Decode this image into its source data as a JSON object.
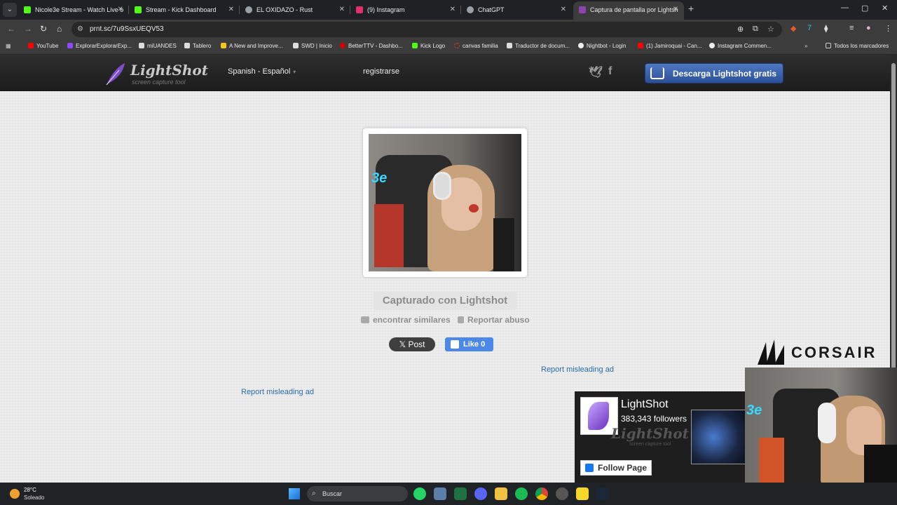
{
  "browser": {
    "tabs": [
      {
        "title": "Nicole3e Stream - Watch Live o",
        "color": "#53fc18"
      },
      {
        "title": "Stream - Kick Dashboard",
        "color": "#53fc18"
      },
      {
        "title": "EL OXIDAZO - Rust",
        "color": "#9aa0a6"
      },
      {
        "title": "(9) Instagram",
        "color": "#e1306c"
      },
      {
        "title": "ChatGPT",
        "color": "#9aa0a6"
      },
      {
        "title": "Captura de pantalla por Lightsh",
        "color": "#8e44ad"
      }
    ],
    "url": "prnt.sc/7u9SsxUEQV53",
    "bookmarks": [
      "YouTube",
      "ExplorarExplorarExp...",
      "miUANDES",
      "Tablero",
      "A New and Improve...",
      "SWD | Inicio",
      "BetterTTV - Dashbo...",
      "Kick Logo",
      "canvas familia",
      "Traductor de docum...",
      "Nightbot - Login",
      "(1) Jamiroquai - Can...",
      "Instagram Commen..."
    ],
    "bookmarks_folder": "Todos los marcadores"
  },
  "lightshot": {
    "logo_name": "LightShot",
    "logo_tagline": "screen capture tool",
    "language": "Spanish - Español",
    "register": "registrarse",
    "download_button": "Descarga Lightshot gratis",
    "caption": "Capturado con Lightshot",
    "find_similar": "encontrar similares",
    "report_abuse": "Reportar abuso",
    "x_post": "Post",
    "fb_like": "Like",
    "fb_like_count": "0",
    "report_ad_1": "Report misleading ad",
    "report_ad_2": "Report misleading ad",
    "image_overlay_text": "3e"
  },
  "fb_widget": {
    "page_name": "LightShot",
    "followers": "383,343 followers",
    "watermark": "LightShot",
    "watermark_tagline": "screen capture tool",
    "follow_button": "Follow Page"
  },
  "overlay": {
    "sponsor": "CORSAIR",
    "webcam_neon": "3e"
  },
  "taskbar": {
    "temperature": "28°C",
    "weather": "Soleado",
    "search_placeholder": "Buscar"
  }
}
